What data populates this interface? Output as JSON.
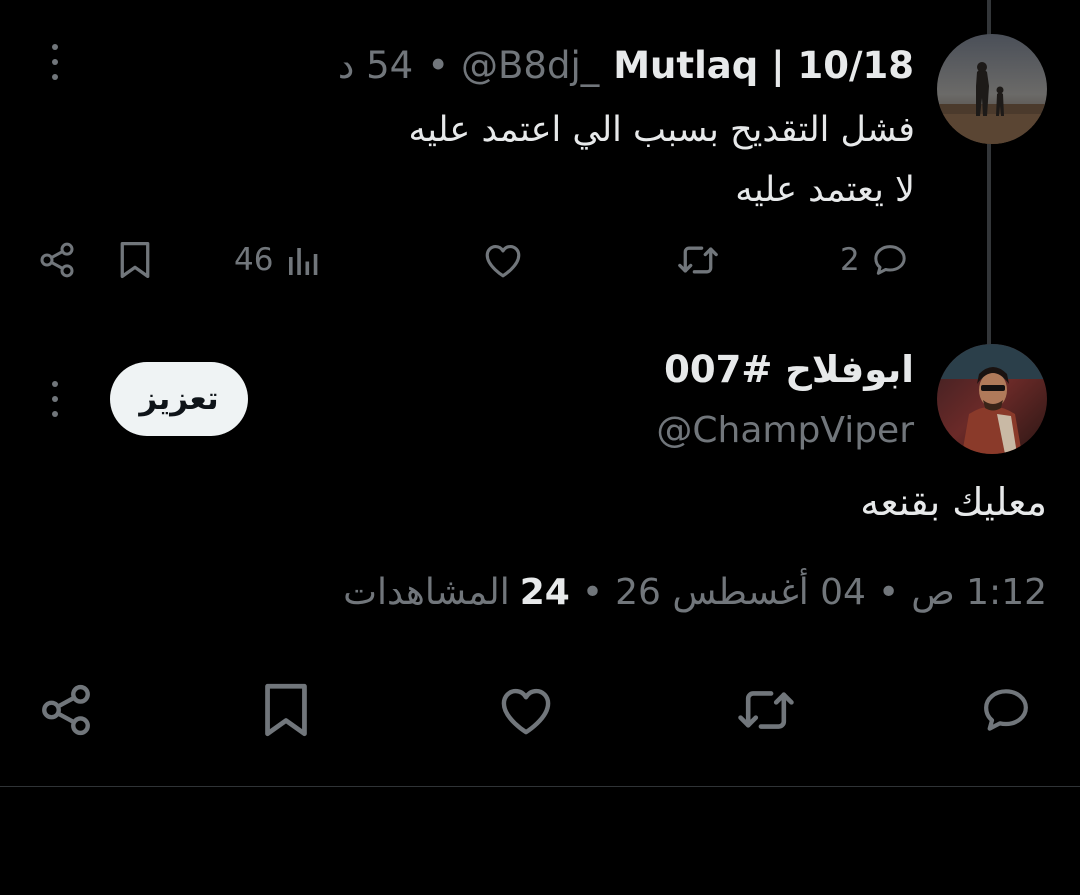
{
  "reply_tweet": {
    "display_name": "Mutlaq | 10/18",
    "handle": "@B8dj_",
    "separator": "•",
    "time_ago": "54 د",
    "text_line_1": "فشل التقديح بسبب الي اعتمد عليه",
    "text_line_2": "لا يعتمد عليه",
    "reply_count": "2",
    "views_count": "46",
    "icons": {
      "reply": "comment-icon",
      "retweet": "retweet-icon",
      "like": "heart-icon",
      "views": "views-chart-icon",
      "bookmark": "bookmark-icon",
      "share": "share-icon",
      "more": "more-vertical-icon"
    }
  },
  "main_tweet": {
    "display_name": "ابوفلاح #007",
    "handle": "@ChampViper",
    "boost_label": "تعزيز",
    "text": "معليك بقنعه",
    "time": "1:12 ص",
    "date": "04 أغسطس 26",
    "separator": "•",
    "views_count": "24",
    "views_label": "المشاهدات"
  },
  "colors": {
    "background": "#000000",
    "primary_text": "#e7e9ea",
    "secondary_text": "#71767b",
    "boost_button_bg": "#eff3f4",
    "divider": "#2f3336",
    "thread_line": "#333639"
  }
}
